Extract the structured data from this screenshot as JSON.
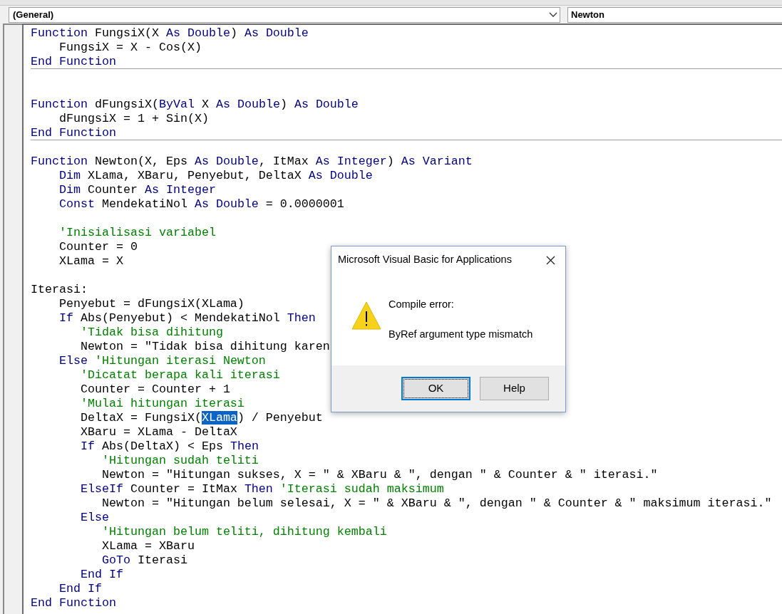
{
  "procedure_bar": {
    "object": "(General)",
    "procedure": "Newton"
  },
  "procedures": [
    {
      "lines": [
        {
          "kind": "code",
          "tokens": [
            {
              "kind": "keyword",
              "text": "Function"
            },
            {
              "kind": "plain",
              "text": " FungsiX(X "
            },
            {
              "kind": "keyword",
              "text": "As Double"
            },
            {
              "kind": "plain",
              "text": ") "
            },
            {
              "kind": "keyword",
              "text": "As Double"
            }
          ]
        },
        {
          "kind": "code",
          "tokens": [
            {
              "kind": "plain",
              "text": "    FungsiX = X - Cos(X)"
            }
          ]
        },
        {
          "kind": "code",
          "tokens": [
            {
              "kind": "keyword",
              "text": "End Function"
            }
          ]
        }
      ]
    },
    {
      "lines": [
        {
          "kind": "blank"
        },
        {
          "kind": "blank"
        },
        {
          "kind": "code",
          "tokens": [
            {
              "kind": "keyword",
              "text": "Function"
            },
            {
              "kind": "plain",
              "text": " dFungsiX("
            },
            {
              "kind": "keyword",
              "text": "ByVal"
            },
            {
              "kind": "plain",
              "text": " X "
            },
            {
              "kind": "keyword",
              "text": "As Double"
            },
            {
              "kind": "plain",
              "text": ") "
            },
            {
              "kind": "keyword",
              "text": "As Double"
            }
          ]
        },
        {
          "kind": "code",
          "tokens": [
            {
              "kind": "plain",
              "text": "    dFungsiX = 1 + Sin(X)"
            }
          ]
        },
        {
          "kind": "code",
          "tokens": [
            {
              "kind": "keyword",
              "text": "End Function"
            }
          ]
        }
      ]
    },
    {
      "lines": [
        {
          "kind": "blank"
        },
        {
          "kind": "code",
          "tokens": [
            {
              "kind": "keyword",
              "text": "Function"
            },
            {
              "kind": "plain",
              "text": " Newton(X, Eps "
            },
            {
              "kind": "keyword",
              "text": "As Double"
            },
            {
              "kind": "plain",
              "text": ", ItMax "
            },
            {
              "kind": "keyword",
              "text": "As Integer"
            },
            {
              "kind": "plain",
              "text": ") "
            },
            {
              "kind": "keyword",
              "text": "As Variant"
            }
          ]
        },
        {
          "kind": "code",
          "tokens": [
            {
              "kind": "keyword",
              "text": "    Dim"
            },
            {
              "kind": "plain",
              "text": " XLama, XBaru, Penyebut, DeltaX "
            },
            {
              "kind": "keyword",
              "text": "As Double"
            }
          ]
        },
        {
          "kind": "code",
          "tokens": [
            {
              "kind": "keyword",
              "text": "    Dim"
            },
            {
              "kind": "plain",
              "text": " Counter "
            },
            {
              "kind": "keyword",
              "text": "As Integer"
            }
          ]
        },
        {
          "kind": "code",
          "tokens": [
            {
              "kind": "keyword",
              "text": "    Const"
            },
            {
              "kind": "plain",
              "text": " MendekatiNol "
            },
            {
              "kind": "keyword",
              "text": "As Double"
            },
            {
              "kind": "plain",
              "text": " = 0.0000001"
            }
          ]
        },
        {
          "kind": "blank"
        },
        {
          "kind": "code",
          "tokens": [
            {
              "kind": "comment",
              "text": "    'Inisialisasi variabel"
            }
          ]
        },
        {
          "kind": "code",
          "tokens": [
            {
              "kind": "plain",
              "text": "    Counter = 0"
            }
          ]
        },
        {
          "kind": "code",
          "tokens": [
            {
              "kind": "plain",
              "text": "    XLama = X"
            }
          ]
        },
        {
          "kind": "blank"
        },
        {
          "kind": "code",
          "tokens": [
            {
              "kind": "plain",
              "text": "Iterasi:"
            }
          ]
        },
        {
          "kind": "code",
          "tokens": [
            {
              "kind": "plain",
              "text": "    Penyebut = dFungsiX(XLama)"
            }
          ]
        },
        {
          "kind": "code",
          "tokens": [
            {
              "kind": "keyword",
              "text": "    If"
            },
            {
              "kind": "plain",
              "text": " Abs(Penyebut) < MendekatiNol "
            },
            {
              "kind": "keyword",
              "text": "Then"
            }
          ]
        },
        {
          "kind": "code",
          "tokens": [
            {
              "kind": "comment",
              "text": "       'Tidak bisa dihitung"
            }
          ]
        },
        {
          "kind": "code",
          "tokens": [
            {
              "kind": "plain",
              "text": "       Newton = \"Tidak bisa dihitung karen"
            }
          ]
        },
        {
          "kind": "code",
          "tokens": [
            {
              "kind": "keyword",
              "text": "    Else"
            },
            {
              "kind": "comment",
              "text": " 'Hitungan iterasi Newton"
            }
          ]
        },
        {
          "kind": "code",
          "tokens": [
            {
              "kind": "comment",
              "text": "       'Dicatat berapa kali iterasi"
            }
          ]
        },
        {
          "kind": "code",
          "tokens": [
            {
              "kind": "plain",
              "text": "       Counter = Counter + 1"
            }
          ]
        },
        {
          "kind": "code",
          "tokens": [
            {
              "kind": "comment",
              "text": "       'Mulai hitungan iterasi"
            }
          ]
        },
        {
          "kind": "code",
          "tokens": [
            {
              "kind": "plain",
              "text": "       DeltaX = FungsiX("
            },
            {
              "kind": "selected",
              "text": "XLama"
            },
            {
              "kind": "plain",
              "text": ") / Penyebut"
            }
          ]
        },
        {
          "kind": "code",
          "tokens": [
            {
              "kind": "plain",
              "text": "       XBaru = XLama - DeltaX"
            }
          ]
        },
        {
          "kind": "code",
          "tokens": [
            {
              "kind": "keyword",
              "text": "       If"
            },
            {
              "kind": "plain",
              "text": " Abs(DeltaX) < Eps "
            },
            {
              "kind": "keyword",
              "text": "Then"
            }
          ]
        },
        {
          "kind": "code",
          "tokens": [
            {
              "kind": "comment",
              "text": "          'Hitungan sudah teliti"
            }
          ]
        },
        {
          "kind": "code",
          "tokens": [
            {
              "kind": "plain",
              "text": "          Newton = \"Hitungan sukses, X = \" & XBaru & \", dengan \" & Counter & \" iterasi.\""
            }
          ]
        },
        {
          "kind": "code",
          "tokens": [
            {
              "kind": "keyword",
              "text": "       ElseIf"
            },
            {
              "kind": "plain",
              "text": " Counter = ItMax "
            },
            {
              "kind": "keyword",
              "text": "Then"
            },
            {
              "kind": "comment",
              "text": " 'Iterasi sudah maksimum"
            }
          ]
        },
        {
          "kind": "code",
          "tokens": [
            {
              "kind": "plain",
              "text": "          Newton = \"Hitungan belum selesai, X = \" & XBaru & \", dengan \" & Counter & \" maksimum iterasi.\""
            }
          ]
        },
        {
          "kind": "code",
          "tokens": [
            {
              "kind": "keyword",
              "text": "       Else"
            }
          ]
        },
        {
          "kind": "code",
          "tokens": [
            {
              "kind": "comment",
              "text": "          'Hitungan belum teliti, dihitung kembali"
            }
          ]
        },
        {
          "kind": "code",
          "tokens": [
            {
              "kind": "plain",
              "text": "          XLama = XBaru"
            }
          ]
        },
        {
          "kind": "code",
          "tokens": [
            {
              "kind": "keyword",
              "text": "          GoTo"
            },
            {
              "kind": "plain",
              "text": " Iterasi"
            }
          ]
        },
        {
          "kind": "code",
          "tokens": [
            {
              "kind": "keyword",
              "text": "       End If"
            }
          ]
        },
        {
          "kind": "code",
          "tokens": [
            {
              "kind": "keyword",
              "text": "    End If"
            }
          ]
        },
        {
          "kind": "code",
          "tokens": [
            {
              "kind": "keyword",
              "text": "End Function"
            }
          ]
        }
      ]
    }
  ],
  "dialog": {
    "title": "Microsoft Visual Basic for Applications",
    "heading": "Compile error:",
    "message": "ByRef argument type mismatch",
    "buttons": [
      {
        "label": "OK",
        "selected": true
      },
      {
        "label": "Help",
        "selected": false
      }
    ]
  }
}
